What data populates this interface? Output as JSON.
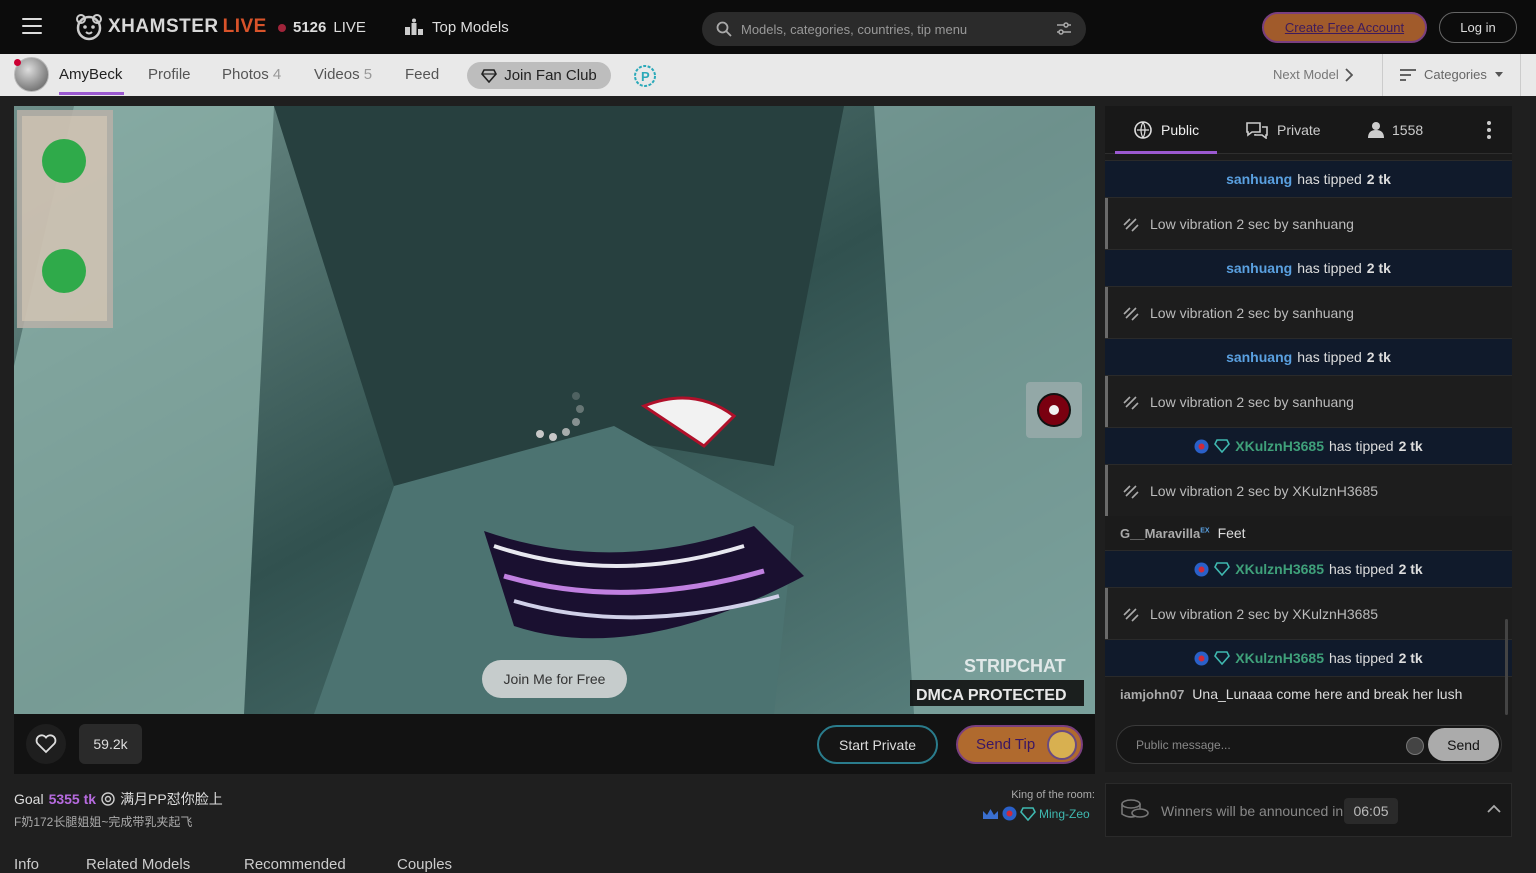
{
  "header": {
    "logo_part1": "XHAMSTER",
    "logo_part2": "LIVE",
    "live_count": "5126",
    "live_label": "LIVE",
    "top_models": "Top Models",
    "search_placeholder": "Models, categories, countries, tip menu",
    "create_account": "Create Free Account",
    "login": "Log in"
  },
  "subnav": {
    "model_name": "AmyBeck",
    "profile": "Profile",
    "photos": "Photos",
    "photos_count": "4",
    "videos": "Videos",
    "videos_count": "5",
    "feed": "Feed",
    "fan_club": "Join Fan Club",
    "next_model": "Next Model",
    "categories": "Categories"
  },
  "video": {
    "join_free": "Join Me for Free",
    "watermark1": "STRIPCHAT",
    "watermark2": "DMCA PROTECTED",
    "likes": "59.2k",
    "start_private": "Start Private",
    "send_tip": "Send Tip"
  },
  "goal": {
    "label": "Goal",
    "amount": "5355 tk",
    "text": "满月PP怼你脸上",
    "subtitle": "F奶172长腿姐姐~完成带乳夹起飞",
    "king_label": "King of the room:",
    "king_name": "Ming-Zeo"
  },
  "bottom_tabs": [
    "Info",
    "Related Models",
    "Recommended",
    "Couples"
  ],
  "chat": {
    "tab_public": "Public",
    "tab_private": "Private",
    "viewers": "1558",
    "messages": [
      {
        "type": "tip",
        "user": "sanhuang",
        "text": "has tipped",
        "amount": "2 tk"
      },
      {
        "type": "vib",
        "text": "Low vibration 2 sec by sanhuang"
      },
      {
        "type": "tip",
        "user": "sanhuang",
        "text": "has tipped",
        "amount": "2 tk"
      },
      {
        "type": "vib",
        "text": "Low vibration 2 sec by sanhuang"
      },
      {
        "type": "tip",
        "user": "sanhuang",
        "text": "has tipped",
        "amount": "2 tk"
      },
      {
        "type": "vib",
        "text": "Low vibration 2 sec by sanhuang"
      },
      {
        "type": "tipg",
        "user": "XKulznH3685",
        "text": "has tipped",
        "amount": "2 tk"
      },
      {
        "type": "vib",
        "text": "Low vibration 2 sec by XKulznH3685"
      },
      {
        "type": "user",
        "user": "G__Maravilla",
        "badge": "EX",
        "text": "Feet"
      },
      {
        "type": "tipg",
        "user": "XKulznH3685",
        "text": "has tipped",
        "amount": "2 tk"
      },
      {
        "type": "vib",
        "text": "Low vibration 2 sec by XKulznH3685"
      },
      {
        "type": "tipg",
        "user": "XKulznH3685",
        "text": "has tipped",
        "amount": "2 tk"
      },
      {
        "type": "user",
        "user": "iamjohn07",
        "badge": "",
        "text": "Una_Lunaaa come here and break her lush"
      }
    ],
    "input_placeholder": "Public message...",
    "send": "Send"
  },
  "winners": {
    "text": "Winners will be announced in",
    "timer": "06:05"
  },
  "colors": {
    "accent": "#9b59d0",
    "tip_user": "#5aa0e0",
    "tip_user_green": "#3fa07a",
    "create_btn": "#a15b2b"
  }
}
